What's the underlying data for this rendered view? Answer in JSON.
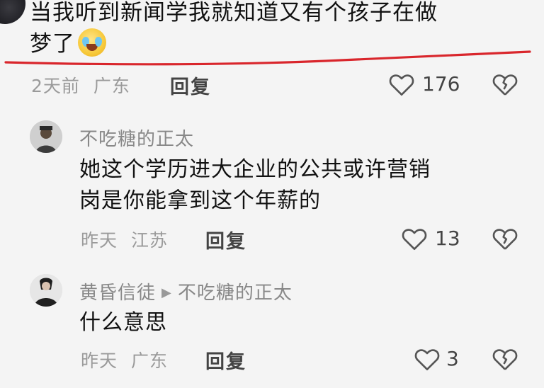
{
  "top_comment": {
    "text_line1": "当我听到新闻学我就知道又有个孩子在做",
    "text_line2": "梦了",
    "time": "2天前",
    "location": "广东",
    "reply_label": "回复",
    "like_count": "176"
  },
  "replies": [
    {
      "username": "不吃糖的正太",
      "text_line1": "她这个学历进大企业的公共或许营销",
      "text_line2": "岗是你能拿到这个年薪的",
      "time": "昨天",
      "location": "江苏",
      "reply_label": "回复",
      "like_count": "13"
    },
    {
      "username": "黄昏信徒",
      "reply_to": "不吃糖的正太",
      "text": "什么意思",
      "time": "昨天",
      "location": "广东",
      "reply_label": "回复",
      "like_count": "3"
    }
  ],
  "colors": {
    "background": "#f4f4f4",
    "annotation_line": "#d9262c",
    "meta_text": "#9a9a9a"
  }
}
